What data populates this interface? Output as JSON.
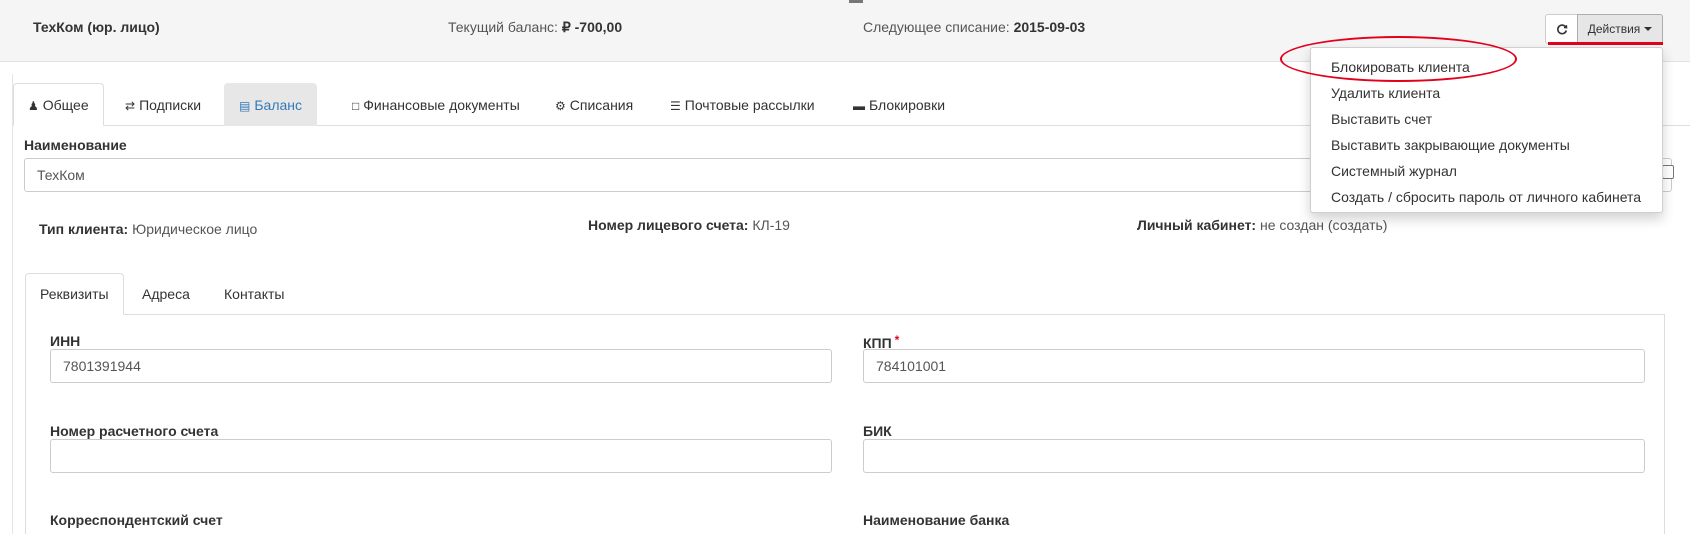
{
  "header": {
    "client_name": "ТехКом (юр. лицо)",
    "balance_label": "Текущий баланс:",
    "balance_value": "₽ -700,00",
    "next_charge_label": "Следующее списание:",
    "next_charge_value": "2015-09-03",
    "refresh_icon": "refresh-icon",
    "actions_label": "Действия"
  },
  "actions_menu": {
    "items": [
      "Блокировать клиента",
      "Удалить клиента",
      "Выставить счет",
      "Выставить закрывающие документы",
      "Системный журнал",
      "Создать / сбросить пароль от личного кабинета"
    ]
  },
  "tabs": [
    {
      "label": "Общее",
      "icon": "user-icon"
    },
    {
      "label": "Подписки",
      "icon": "exchange-icon"
    },
    {
      "label": "Баланс",
      "icon": "money-icon"
    },
    {
      "label": "Финансовые документы",
      "icon": "file-icon"
    },
    {
      "label": "Списания",
      "icon": "gear-icon"
    },
    {
      "label": "Почтовые рассылки",
      "icon": "list-icon"
    },
    {
      "label": "Блокировки",
      "icon": "minus-square-icon"
    }
  ],
  "form": {
    "name_label": "Наименование",
    "name_value": "ТехКом",
    "client_type_label": "Тип клиента:",
    "client_type_value": "Юридическое лицо",
    "account_label": "Номер лицевого счета:",
    "account_value": "КЛ-19",
    "cabinet_label": "Личный кабинет:",
    "cabinet_value": "не создан",
    "cabinet_link": "(создать)"
  },
  "inner_tabs": [
    "Реквизиты",
    "Адреса",
    "Контакты"
  ],
  "requisites": {
    "inn_label": "ИНН",
    "inn_value": "7801391944",
    "kpp_label": "КПП",
    "kpp_required": "*",
    "kpp_value": "784101001",
    "account_number_label": "Номер расчетного счета",
    "bik_label": "БИК",
    "corr_account_label": "Корреспондентский счет",
    "bank_name_label": "Наименование банка"
  },
  "colors": {
    "annotation_red": "#e3001b",
    "link_blue": "#337ab7"
  }
}
